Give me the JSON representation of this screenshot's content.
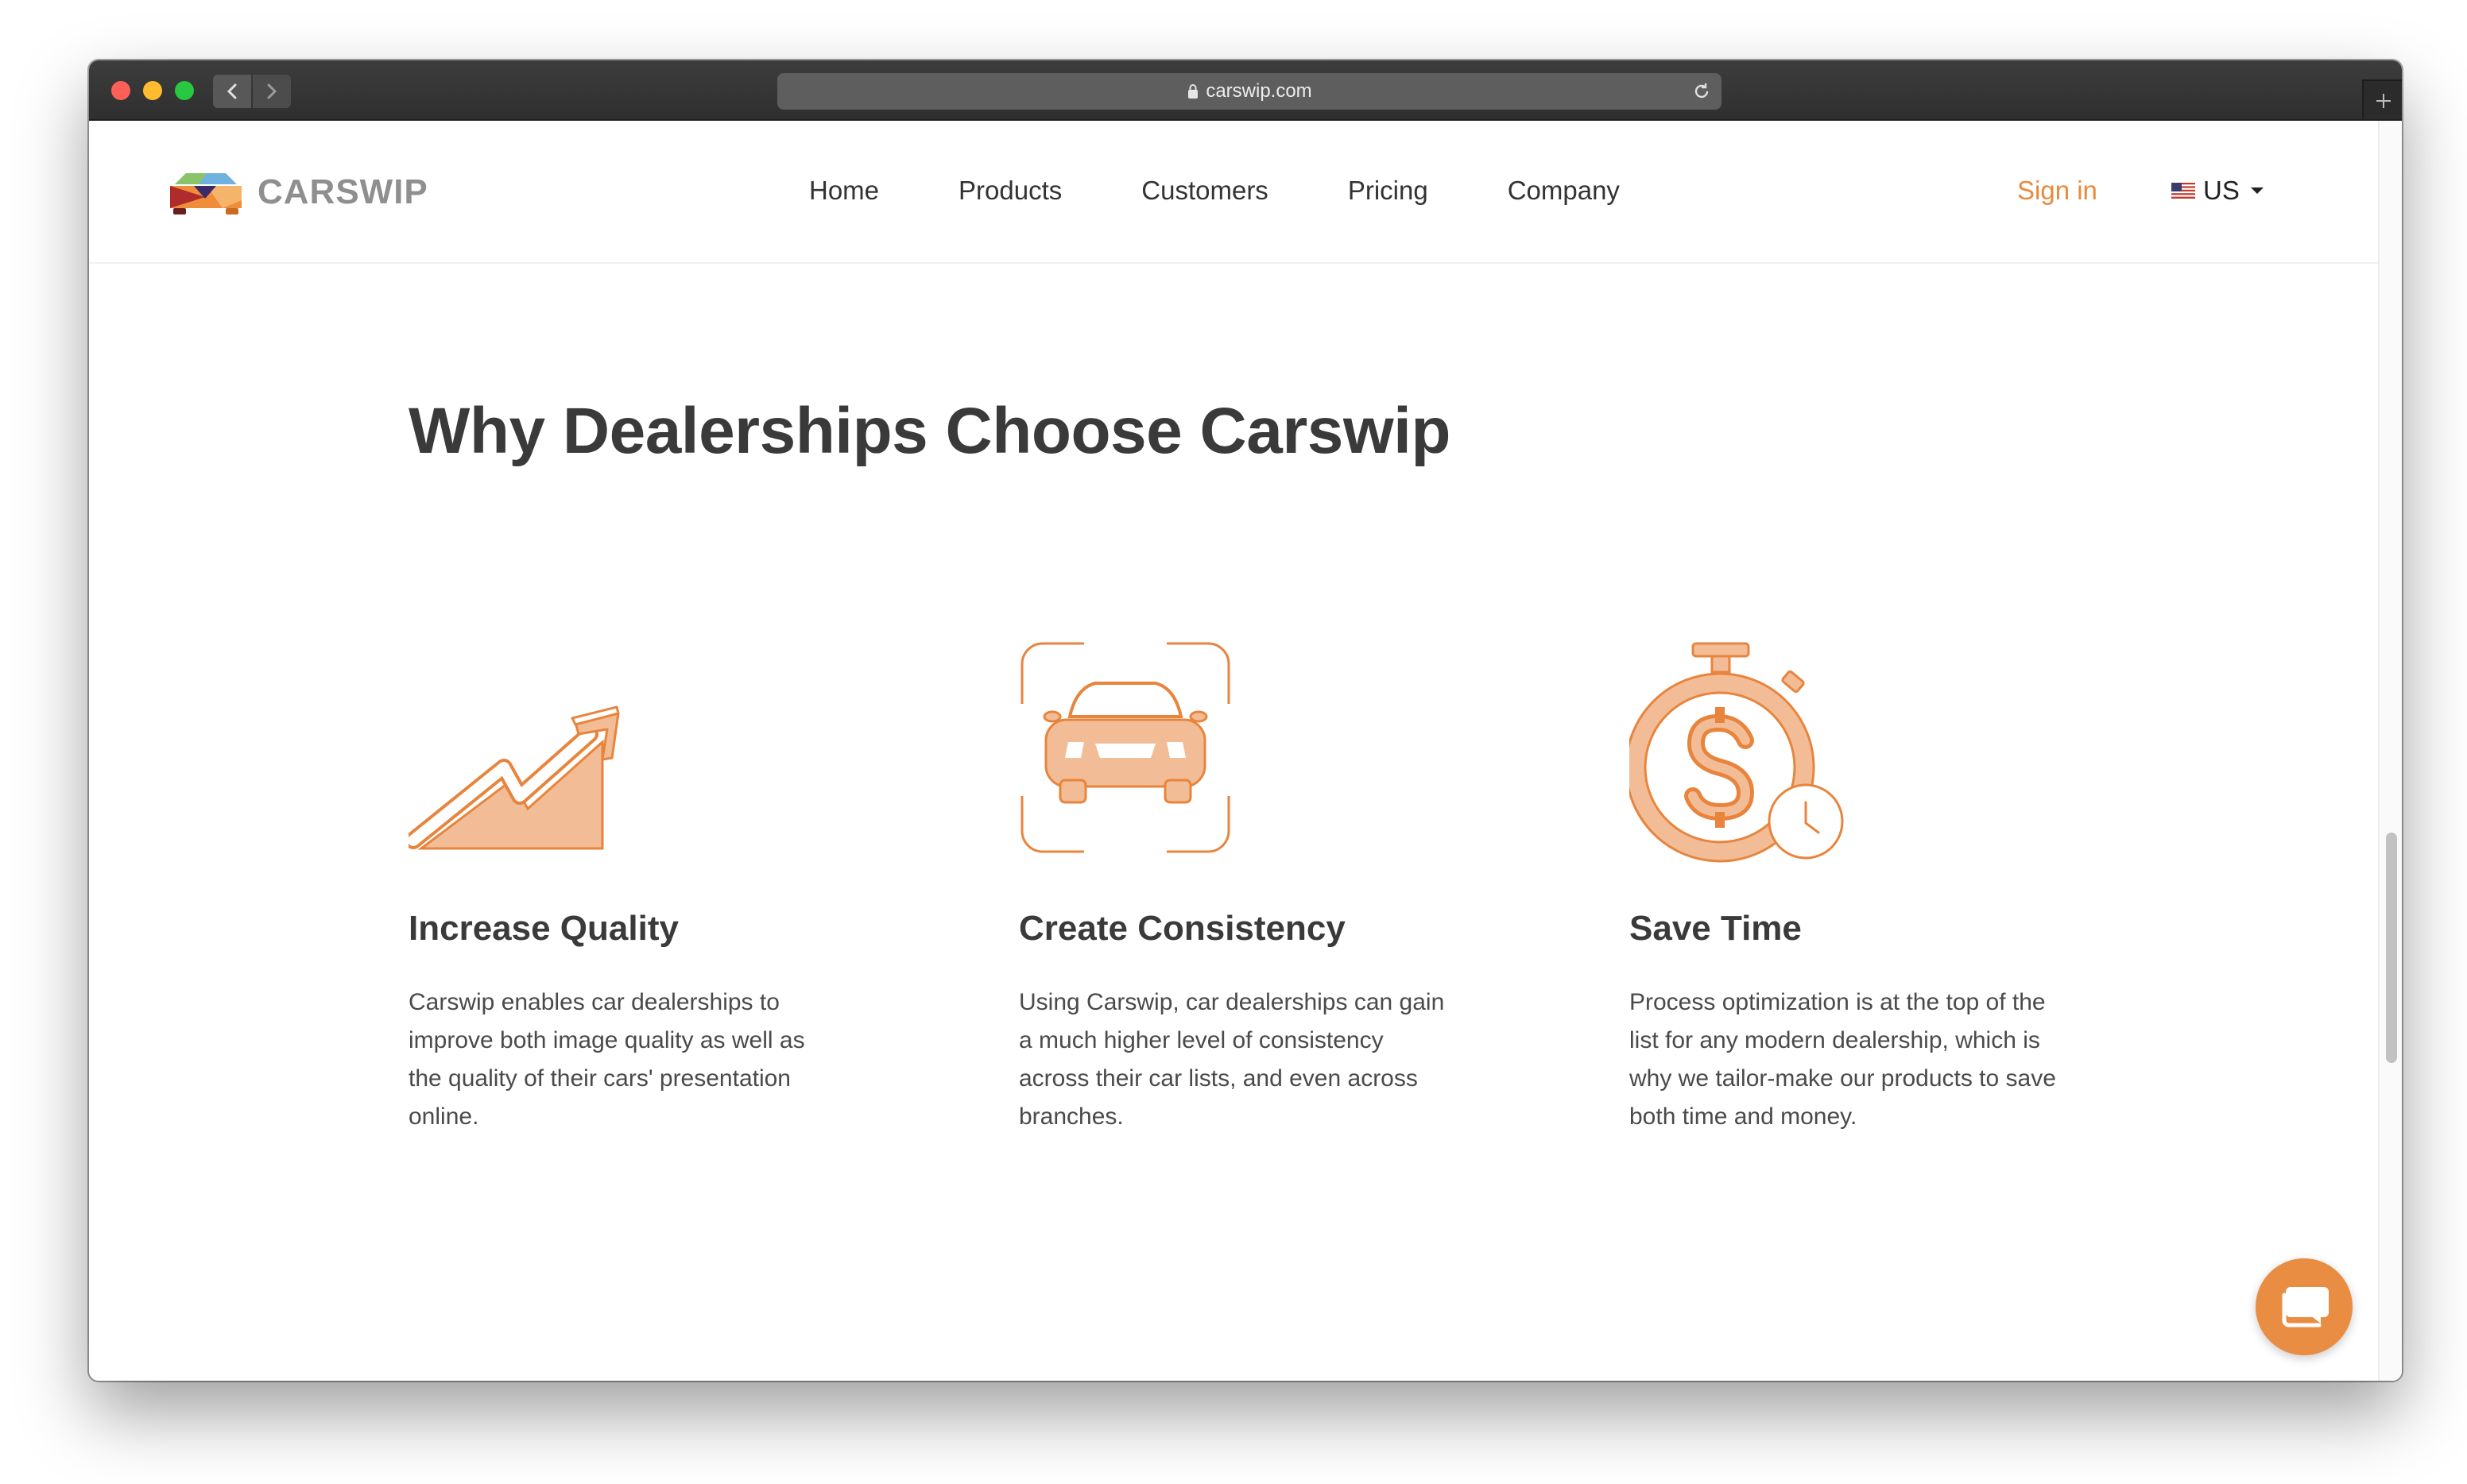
{
  "browser": {
    "url": "carswip.com",
    "icons": [
      "back-arrow-icon",
      "forward-arrow-icon",
      "lock-icon",
      "reload-icon",
      "new-tab-icon"
    ]
  },
  "nav": {
    "logo_text": "CARSWIP",
    "items": [
      {
        "label": "Home"
      },
      {
        "label": "Products"
      },
      {
        "label": "Customers"
      },
      {
        "label": "Pricing"
      },
      {
        "label": "Company"
      }
    ],
    "signin": "Sign in",
    "locale": "US"
  },
  "main": {
    "headline": "Why Dealerships Choose Carswip",
    "features": [
      {
        "icon": "growth-chart-icon",
        "title": "Increase Quality",
        "text": "Carswip enables car dealerships to improve both image quality as well as the quality of their cars' presentation online."
      },
      {
        "icon": "car-frame-icon",
        "title": "Create Consistency",
        "text": "Using Carswip, car dealerships can gain a much higher level of consistency across their car lists, and even across branches."
      },
      {
        "icon": "money-stopwatch-icon",
        "title": "Save Time",
        "text": "Process optimization is at the top of the list for any modern dealership, which is why we tailor-make our products to save both time and money."
      }
    ]
  },
  "chat": {
    "icon": "chat-bubble-icon"
  },
  "colors": {
    "accent": "#e98d43",
    "heading": "#3a3a3a",
    "body_text": "#4a4a4a",
    "icon_fill": "#f2bd96"
  }
}
